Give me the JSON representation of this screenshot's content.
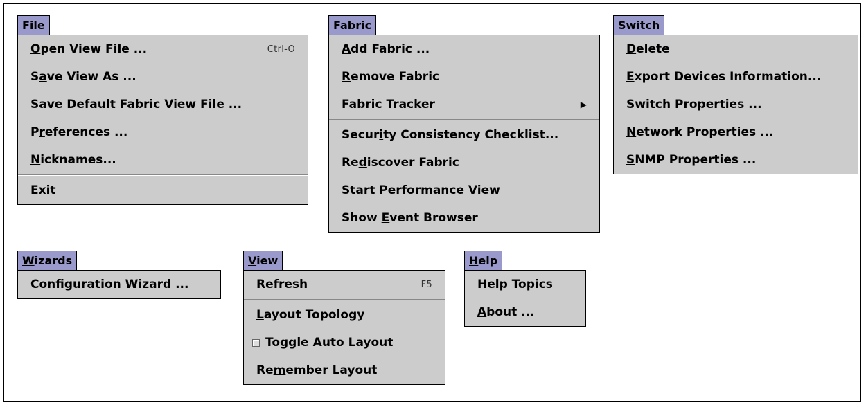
{
  "menus": {
    "file": {
      "title_pre": "",
      "title_u": "F",
      "title_post": "ile",
      "items": [
        {
          "pre": "",
          "u": "O",
          "post": "pen View File ...",
          "shortcut": "Ctrl-O"
        },
        {
          "pre": "S",
          "u": "a",
          "post": "ve View As ..."
        },
        {
          "pre": "Save ",
          "u": "D",
          "post": "efault Fabric View File ..."
        },
        {
          "pre": "P",
          "u": "r",
          "post": "eferences ..."
        },
        {
          "pre": "",
          "u": "N",
          "post": "icknames..."
        },
        {
          "pre": "E",
          "u": "x",
          "post": "it"
        }
      ]
    },
    "fabric": {
      "title_pre": "Fa",
      "title_u": "b",
      "title_post": "ric",
      "items": [
        {
          "pre": "",
          "u": "A",
          "post": "dd Fabric ..."
        },
        {
          "pre": "",
          "u": "R",
          "post": "emove Fabric"
        },
        {
          "pre": "",
          "u": "F",
          "post": "abric Tracker"
        },
        {
          "pre": "Secur",
          "u": "i",
          "post": "ty Consistency Checklist..."
        },
        {
          "pre": "Re",
          "u": "d",
          "post": "iscover Fabric"
        },
        {
          "pre": "S",
          "u": "t",
          "post": "art Performance View"
        },
        {
          "pre": "Show ",
          "u": "E",
          "post": "vent Browser"
        }
      ]
    },
    "switch": {
      "title_pre": "",
      "title_u": "S",
      "title_post": "witch",
      "items": [
        {
          "pre": "",
          "u": "D",
          "post": "elete"
        },
        {
          "pre": "",
          "u": "E",
          "post": "xport Devices Information..."
        },
        {
          "pre": "Switch ",
          "u": "P",
          "post": "roperties ..."
        },
        {
          "pre": "",
          "u": "N",
          "post": "etwork Properties ..."
        },
        {
          "pre": "",
          "u": "S",
          "post": "NMP Properties ..."
        }
      ]
    },
    "wizards": {
      "title_pre": "",
      "title_u": "W",
      "title_post": "izards",
      "items": [
        {
          "pre": "",
          "u": "C",
          "post": "onfiguration Wizard ..."
        }
      ]
    },
    "view": {
      "title_pre": "",
      "title_u": "V",
      "title_post": "iew",
      "items": [
        {
          "pre": "",
          "u": "R",
          "post": "efresh",
          "shortcut": "F5"
        },
        {
          "pre": "",
          "u": "L",
          "post": "ayout Topology"
        },
        {
          "pre": "Toggle ",
          "u": "A",
          "post": "uto Layout"
        },
        {
          "pre": "Re",
          "u": "m",
          "post": "ember Layout"
        }
      ]
    },
    "help": {
      "title_pre": "",
      "title_u": "H",
      "title_post": "elp",
      "items": [
        {
          "pre": "",
          "u": "H",
          "post": "elp Topics"
        },
        {
          "pre": "",
          "u": "A",
          "post": "bout ..."
        }
      ]
    }
  },
  "colors": {
    "title_bg": "#9999cc",
    "panel_bg": "#cccccc"
  },
  "icons": {
    "submenu": "arrow-right-icon",
    "checkbox": "checkbox-icon"
  }
}
